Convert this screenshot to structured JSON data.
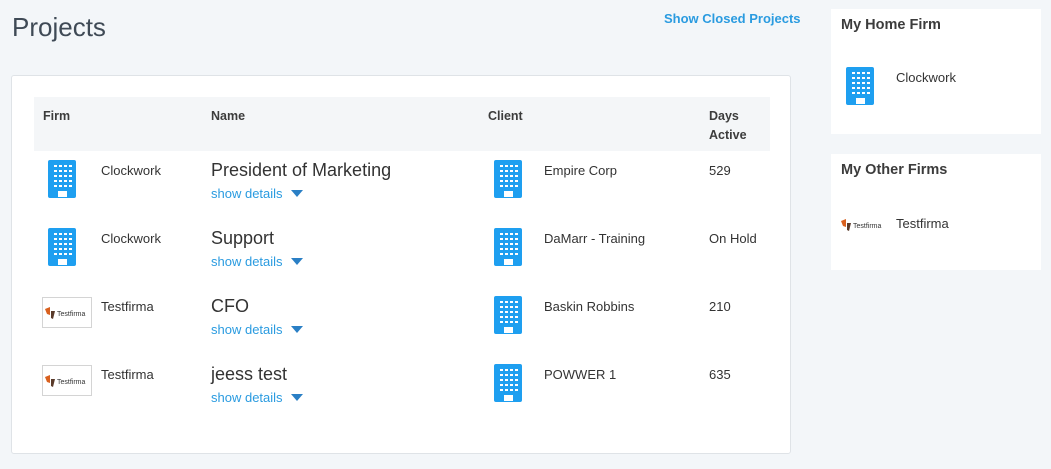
{
  "page": {
    "title": "Projects",
    "show_closed_label": "Show Closed Projects"
  },
  "table": {
    "headers": {
      "firm": "Firm",
      "name": "Name",
      "client": "Client",
      "days_active_line1": "Days",
      "days_active_line2": "Active"
    },
    "show_details_label": "show details",
    "rows": [
      {
        "firm": "Clockwork",
        "firm_logo": "building-icon",
        "name": "President of Marketing",
        "client": "Empire Corp",
        "days_active": "529"
      },
      {
        "firm": "Clockwork",
        "firm_logo": "building-icon",
        "name": "Support",
        "client": "DaMarr - Training",
        "days_active": "On Hold"
      },
      {
        "firm": "Testfirma",
        "firm_logo": "testfirma-logo",
        "name": "CFO",
        "client": "Baskin Robbins",
        "days_active": "210"
      },
      {
        "firm": "Testfirma",
        "firm_logo": "testfirma-logo",
        "name": "jeess test",
        "client": "POWWER 1",
        "days_active": "635"
      }
    ]
  },
  "sidebar": {
    "home_firm": {
      "title": "My Home Firm",
      "name": "Clockwork",
      "logo": "building-icon"
    },
    "other_firms": {
      "title": "My Other Firms",
      "items": [
        {
          "name": "Testfirma",
          "logo": "testfirma-logo",
          "logo_text": "Testfirma"
        }
      ]
    }
  },
  "colors": {
    "accent": "#2a9be0",
    "icon_blue": "#1e9ff0",
    "background": "#f3f6f9",
    "testfirma_orange": "#d9601e"
  }
}
